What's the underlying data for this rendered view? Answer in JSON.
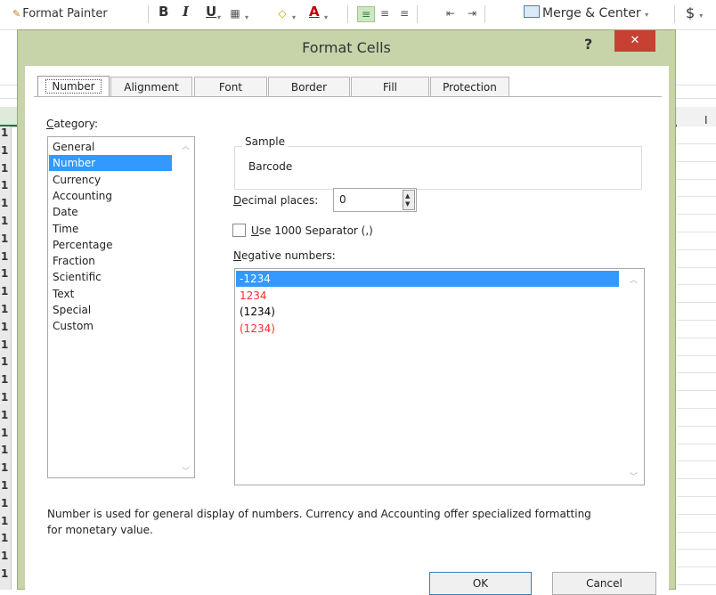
{
  "excel": {
    "format_painter": "Format Painter",
    "bold": "B",
    "italic": "I",
    "underline": "U",
    "merge_center": "Merge & Center",
    "currency_symbol": "$",
    "font_color_letter": "A",
    "row_labels": [
      "1",
      "1",
      "1",
      "1",
      "1",
      "1",
      "1",
      "1",
      "1",
      "1",
      "1",
      "1",
      "1",
      "1",
      "1",
      "1",
      "1",
      "1",
      "1",
      "1",
      "1",
      "1",
      "1",
      "1",
      "1",
      "1"
    ],
    "header_stray": "I",
    "accent_color": "#217346"
  },
  "dialog": {
    "title": "Format Cells",
    "help": "?",
    "close": "✕",
    "tabs": [
      "Number",
      "Alignment",
      "Font",
      "Border",
      "Fill",
      "Protection"
    ],
    "active_tab": "Number",
    "category": {
      "label_accel": "C",
      "label_rest": "ategory:",
      "items": [
        "General",
        "Number",
        "Currency",
        "Accounting",
        "Date",
        "Time",
        "Percentage",
        "Fraction",
        "Scientific",
        "Text",
        "Special",
        "Custom"
      ],
      "selected": "Number"
    },
    "sample": {
      "label": "Sample",
      "value": "Barcode"
    },
    "decimal_places": {
      "label_accel": "D",
      "label_rest": "ecimal places:",
      "value": "0"
    },
    "separator": {
      "label_accel": "U",
      "label_rest": "se 1000 Separator (,)",
      "checked": false
    },
    "negative_numbers": {
      "label_accel": "N",
      "label_rest": "egative numbers:",
      "items": [
        {
          "text": "-1234",
          "color": "#000000"
        },
        {
          "text": "1234",
          "color": "#ff2a2a"
        },
        {
          "text": "(1234)",
          "color": "#000000"
        },
        {
          "text": "(1234)",
          "color": "#ff2a2a"
        }
      ],
      "selected": 0
    },
    "description_line1": "Number is used for general display of numbers.  Currency and Accounting offer specialized formatting",
    "description_line2": "for monetary value.",
    "ok": "OK",
    "cancel": "Cancel"
  }
}
